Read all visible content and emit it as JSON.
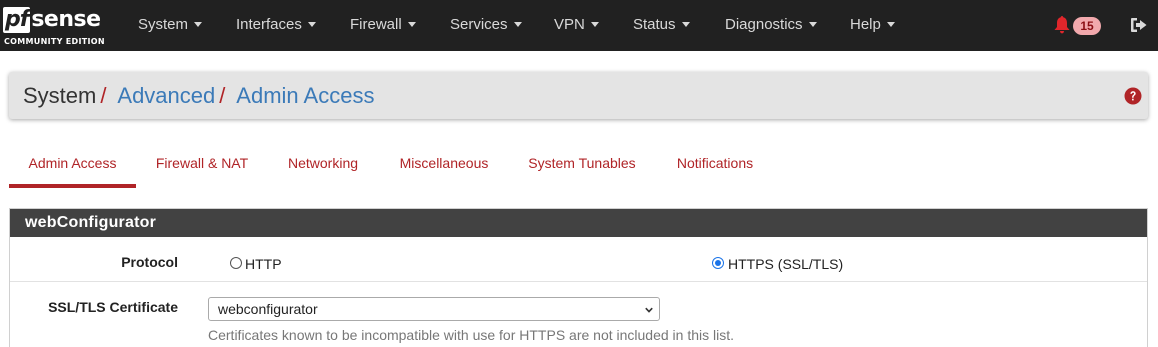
{
  "brand": {
    "name_prefix": "pf",
    "name_suffix": "sense",
    "edition": "COMMUNITY EDITION"
  },
  "nav": {
    "items": [
      {
        "label": "System"
      },
      {
        "label": "Interfaces"
      },
      {
        "label": "Firewall"
      },
      {
        "label": "Services"
      },
      {
        "label": "VPN"
      },
      {
        "label": "Status"
      },
      {
        "label": "Diagnostics"
      },
      {
        "label": "Help"
      }
    ],
    "notification_count": "15"
  },
  "breadcrumb": {
    "root": "System",
    "sep": "/",
    "items": [
      "Advanced",
      "Admin Access"
    ]
  },
  "tabs": [
    {
      "label": "Admin Access",
      "active": true
    },
    {
      "label": "Firewall & NAT"
    },
    {
      "label": "Networking"
    },
    {
      "label": "Miscellaneous"
    },
    {
      "label": "System Tunables"
    },
    {
      "label": "Notifications"
    }
  ],
  "panel": {
    "title": "webConfigurator",
    "protocol": {
      "label": "Protocol",
      "options": [
        "HTTP",
        "HTTPS (SSL/TLS)"
      ],
      "selected": "HTTPS (SSL/TLS)"
    },
    "certificate": {
      "label": "SSL/TLS Certificate",
      "value": "webconfigurator",
      "help": "Certificates known to be incompatible with use for HTTPS are not included in this list."
    }
  },
  "colors": {
    "navbar": "#212121",
    "accent_red": "#b02427",
    "link_blue": "#3b7ab8",
    "panel_heading": "#424242"
  },
  "icons": [
    "bell-icon",
    "logout-icon",
    "help-circle-icon",
    "chevron-down-icon"
  ]
}
